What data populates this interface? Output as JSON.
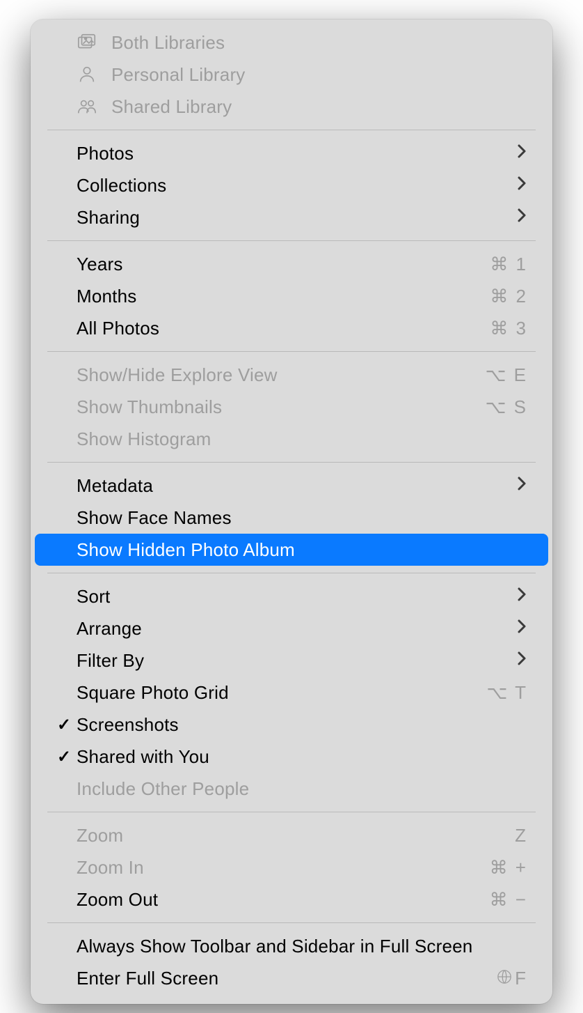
{
  "libraries": {
    "both": "Both Libraries",
    "personal": "Personal Library",
    "shared": "Shared Library"
  },
  "nav": {
    "photos": "Photos",
    "collections": "Collections",
    "sharing": "Sharing"
  },
  "time": {
    "years": {
      "label": "Years",
      "shortcut": "⌘ 1"
    },
    "months": {
      "label": "Months",
      "shortcut": "⌘ 2"
    },
    "all": {
      "label": "All Photos",
      "shortcut": "⌘ 3"
    }
  },
  "view": {
    "explore": {
      "label": "Show/Hide Explore View",
      "shortcut": "⌥ E"
    },
    "thumbnails": {
      "label": "Show Thumbnails",
      "shortcut": "⌥ S"
    },
    "histogram": {
      "label": "Show Histogram",
      "shortcut": ""
    }
  },
  "meta": {
    "metadata": "Metadata",
    "face": "Show Face Names",
    "hidden": "Show Hidden Photo Album"
  },
  "arrange": {
    "sort": "Sort",
    "arrange": "Arrange",
    "filter": "Filter By",
    "square": {
      "label": "Square Photo Grid",
      "shortcut": "⌥ T"
    },
    "screenshots": "Screenshots",
    "shared_with_you": "Shared with You",
    "include_other": "Include Other People"
  },
  "zoom": {
    "zoom": {
      "label": "Zoom",
      "shortcut": "Z"
    },
    "in": {
      "label": "Zoom In",
      "shortcut": "⌘ +"
    },
    "out": {
      "label": "Zoom Out",
      "shortcut": "⌘ −"
    }
  },
  "fullscreen": {
    "toolbar": "Always Show Toolbar and Sidebar in Full Screen",
    "enter": {
      "label": "Enter Full Screen",
      "shortcut": "F"
    }
  }
}
